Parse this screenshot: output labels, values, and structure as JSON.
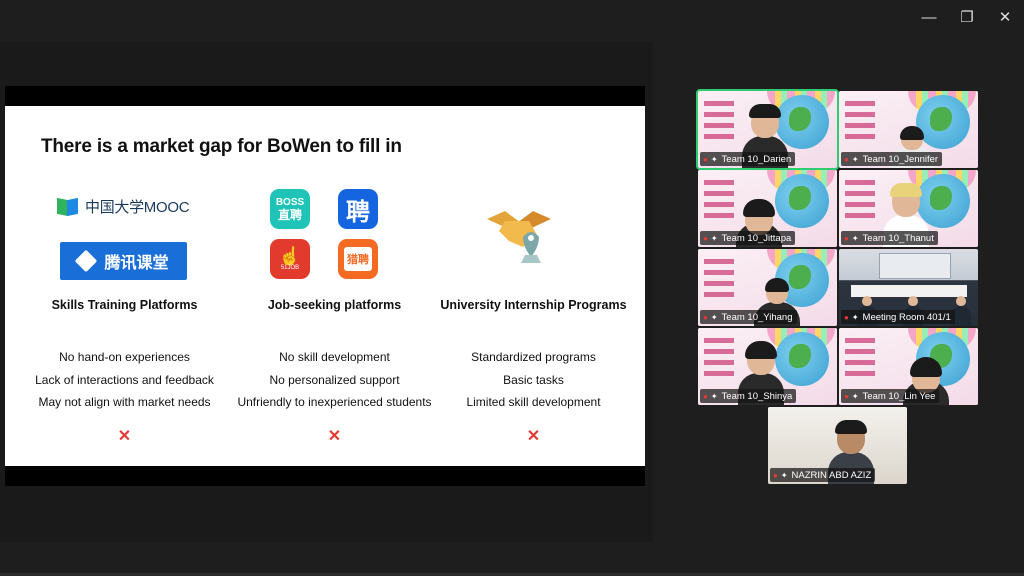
{
  "window": {
    "minimize_icon": "—",
    "restore_icon": "❐",
    "close_icon": "✕"
  },
  "slide": {
    "title": "There is a market gap for BoWen to fill in",
    "columns": [
      {
        "heading": "Skills Training Platforms",
        "items": [
          "No hand-on experiences",
          "Lack of interactions and feedback",
          "May not align with market needs"
        ],
        "mark": "✕"
      },
      {
        "heading": "Job-seeking platforms",
        "items": [
          "No skill development",
          "No personalized support",
          "Unfriendly to inexperienced students"
        ],
        "mark": "✕"
      },
      {
        "heading": "University Internship Programs",
        "items": [
          "Standardized programs",
          "Basic tasks",
          "Limited skill development"
        ],
        "mark": "✕"
      }
    ],
    "logos": {
      "mooc": "中国大学MOOC",
      "tencent": "腾讯课堂",
      "boss_line1": "BOSS",
      "boss_line2": "直聘",
      "pin": "聘",
      "job51": "51JOB",
      "liepin": "猎聘"
    }
  },
  "participants": [
    {
      "name": "Team 10_Darien",
      "active": true
    },
    {
      "name": "Team 10_Jennifer",
      "active": false
    },
    {
      "name": "Team 10_Jittapa",
      "active": false
    },
    {
      "name": "Team 10_Thanut",
      "active": false
    },
    {
      "name": "Team 10_Yihang",
      "active": false
    },
    {
      "name": "Meeting Room 401/1",
      "active": false
    },
    {
      "name": "Team 10_Shinya",
      "active": false
    },
    {
      "name": "Team 10_Lin Yee",
      "active": false
    },
    {
      "name": "NAZRIN ABD AZIZ",
      "active": false
    }
  ],
  "colors": {
    "active_border": "#2ecc71",
    "mute": "#e53935",
    "slide_bg": "#ffffff",
    "app_bg": "#1e1e1e"
  }
}
